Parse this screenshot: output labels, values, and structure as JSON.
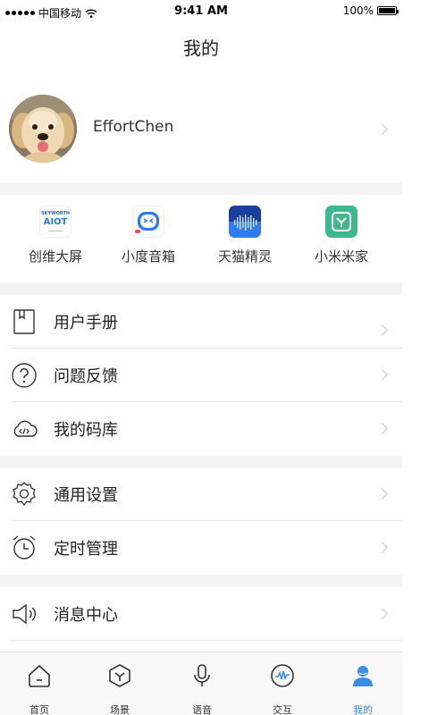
{
  "status_bar": {
    "carrier": "中国移动",
    "time": "9:41 AM",
    "battery": "100%"
  },
  "nav": {
    "title": "我的"
  },
  "profile": {
    "username": "EffortChen"
  },
  "platforms": [
    {
      "label": "创维大屏",
      "icon": "skyworth-aiot-icon",
      "logo_text_top": "SKYWORTH",
      "logo_text_main": "AIOT"
    },
    {
      "label": "小度音箱",
      "icon": "xiaodu-speaker-icon"
    },
    {
      "label": "天猫精灵",
      "icon": "tmall-genie-icon"
    },
    {
      "label": "小米米家",
      "icon": "mijia-icon"
    }
  ],
  "menu_groups": [
    [
      {
        "label": "用户手册",
        "icon": "manual-book-icon"
      },
      {
        "label": "问题反馈",
        "icon": "question-icon"
      },
      {
        "label": "我的码库",
        "icon": "cloud-code-icon"
      }
    ],
    [
      {
        "label": "通用设置",
        "icon": "gear-icon"
      },
      {
        "label": "定时管理",
        "icon": "alarm-clock-icon"
      }
    ],
    [
      {
        "label": "消息中心",
        "icon": "speaker-icon"
      }
    ]
  ],
  "tabbar": {
    "tabs": [
      {
        "label": "首页",
        "icon": "home-icon",
        "active": false
      },
      {
        "label": "场景",
        "icon": "scene-hexagon-icon",
        "active": false
      },
      {
        "label": "语音",
        "icon": "microphone-icon",
        "active": false
      },
      {
        "label": "交互",
        "icon": "interaction-wave-icon",
        "active": false
      },
      {
        "label": "我的",
        "icon": "user-icon",
        "active": true
      }
    ]
  },
  "colors": {
    "accent": "#3b8ee6",
    "mijia_green": "#3fb88e",
    "xiaodu_blue": "#2d7bf3",
    "tmall_blue": "#1f5fd6"
  }
}
